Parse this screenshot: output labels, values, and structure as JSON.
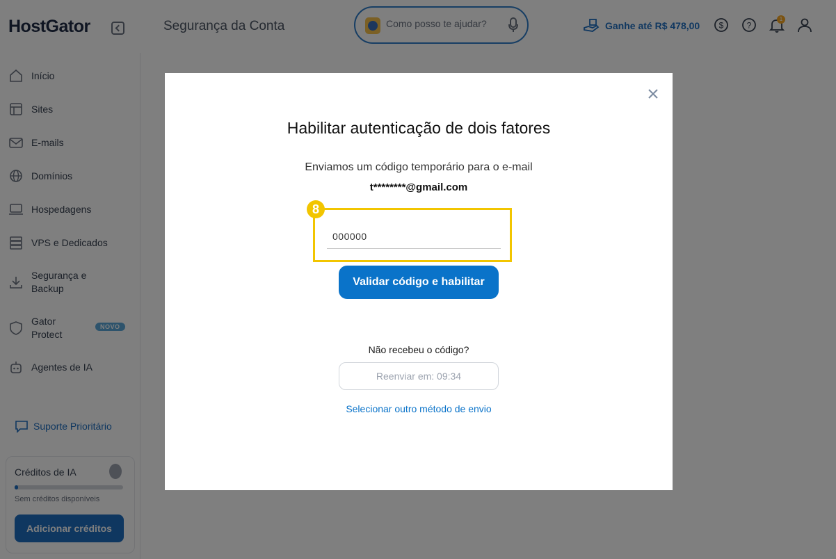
{
  "header": {
    "logo": "HostGator",
    "page_title": "Segurança da Conta",
    "search_placeholder": "Como posso te ajudar?",
    "earn_label": "Ganhe até R$ 478,00",
    "notification_count": "1"
  },
  "sidebar": {
    "items": [
      {
        "label": "Início"
      },
      {
        "label": "Sites"
      },
      {
        "label": "E-mails"
      },
      {
        "label": "Domínios"
      },
      {
        "label": "Hospedagens"
      },
      {
        "label": "VPS e Dedicados"
      },
      {
        "label": "Segurança e Backup"
      },
      {
        "label": "Gator Protect"
      },
      {
        "label": "Agentes de IA"
      }
    ],
    "novo_badge": "NOVO",
    "support_label": "Suporte Prioritário",
    "credits": {
      "title": "Créditos de IA",
      "subtitle": "Sem créditos disponíveis",
      "button": "Adicionar créditos",
      "progress": 0.03
    }
  },
  "modal": {
    "title": "Habilitar autenticação de dois fatores",
    "description": "Enviamos um código temporário para o e-mail",
    "email": "t********@gmail.com",
    "step_badge": "8",
    "code_value": "000000",
    "validate_button": "Validar código e habilitar",
    "not_received": "Não recebeu o código?",
    "resend_button": "Reenviar em: 09:34",
    "other_method_link": "Selecionar outro método de envio"
  },
  "colors": {
    "primary": "#0a73c9",
    "highlight": "#f2c500",
    "overlay": "rgba(0,0,0,0.5)"
  }
}
